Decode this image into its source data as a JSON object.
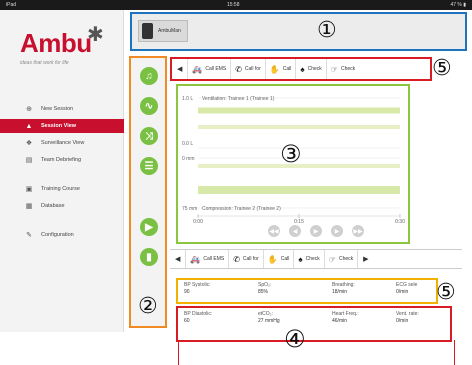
{
  "status_bar": {
    "left": "iPad",
    "time": "15:58",
    "right": "47 % ▮"
  },
  "brand": {
    "logo": "Ambu",
    "tagline": "ideas that work for life"
  },
  "nav": {
    "items": [
      {
        "label": "New Session",
        "icon": "new-session-icon"
      },
      {
        "label": "Session View",
        "icon": "person-icon",
        "active": true
      },
      {
        "label": "Surveillance View",
        "icon": "surveillance-icon"
      },
      {
        "label": "Team Debriefing",
        "icon": "document-icon"
      }
    ],
    "items2": [
      {
        "label": "Training Course",
        "icon": "course-icon"
      },
      {
        "label": "Database",
        "icon": "database-icon"
      }
    ],
    "items3": [
      {
        "label": "Configuration",
        "icon": "wrench-icon"
      }
    ]
  },
  "device": {
    "label": "AmbuMan"
  },
  "markers": {
    "m1": "①",
    "m2": "②",
    "m3": "③",
    "m4": "④",
    "m5a": "⑤",
    "m5b": "⑤"
  },
  "actions": {
    "call_ems": "Call EMS",
    "call_for": "Call for",
    "call": "Call",
    "check": "Check",
    "check2": "Check"
  },
  "chart_data": {
    "type": "line",
    "title_top": "Ventilation: Trainee 1 (Trainee 1)",
    "title_bottom": "Compression: Trainee 2 (Trainee 2)",
    "y_labels": [
      "1.0 L",
      "0.0 L",
      "0 mm",
      "75 mm"
    ],
    "x_labels": [
      "0:00",
      "0:15",
      "0:30"
    ],
    "series": [
      {
        "name": "Ventilation",
        "values": [
          0.75,
          0.75,
          0.75
        ]
      },
      {
        "name": "Compression",
        "values": [
          48,
          48,
          48
        ]
      }
    ]
  },
  "vitals": {
    "row1": [
      {
        "label": "BP Systolic:",
        "value": "90"
      },
      {
        "label": "SpO₂:",
        "value": "85%"
      },
      {
        "label": "Breathing:",
        "value": "18/min"
      },
      {
        "label": "ECG sele",
        "value": "0/min"
      }
    ],
    "row2": [
      {
        "label": "BP Diastolic:",
        "value": "60"
      },
      {
        "label": "etCO₂:",
        "value": "27 mmHg"
      },
      {
        "label": "Heart Freq.:",
        "value": "46/min"
      },
      {
        "label": "Vent. rate:",
        "value": "0/min"
      }
    ]
  },
  "colors": {
    "brand_red": "#c8102e",
    "tool_green": "#7ac143",
    "device_blue": "#1e73be",
    "tool_orange": "#f08a24"
  }
}
